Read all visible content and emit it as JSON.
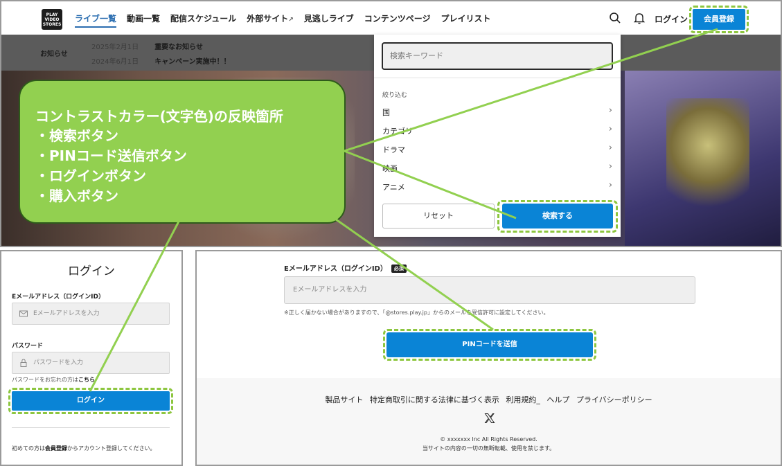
{
  "header": {
    "logo_text": [
      "PLAY",
      "VIDEO",
      "STORES"
    ],
    "nav": [
      {
        "label": "ライブ一覧"
      },
      {
        "label": "動画一覧"
      },
      {
        "label": "配信スケジュール"
      },
      {
        "label": "外部サイト"
      },
      {
        "label": "見逃しライブ"
      },
      {
        "label": "コンテンツページ"
      },
      {
        "label": "プレイリスト"
      }
    ],
    "login_label": "ログイン",
    "register_label": "会員登録",
    "icons": {
      "search": "search-icon",
      "bell": "bell-icon",
      "external": "external-link-icon"
    }
  },
  "notices": {
    "label": "お知らせ",
    "items": [
      {
        "date": "2025年2月1日",
        "text": "重要なお知らせ"
      },
      {
        "date": "2024年6月1日",
        "text": "キャンペーン実施中！！"
      }
    ]
  },
  "search_dropdown": {
    "keyword_placeholder": "検索キーワード",
    "filter_heading": "絞り込む",
    "filters": [
      "国",
      "カテゴリ",
      "ドラマ",
      "映画",
      "アニメ"
    ],
    "reset_label": "リセット",
    "submit_label": "検索する"
  },
  "callout": {
    "title": "コントラストカラー(文字色)の反映箇所",
    "items": [
      "・検索ボタン",
      "・PINコード送信ボタン",
      "・ログインボタン",
      "・購入ボタン"
    ]
  },
  "login": {
    "title": "ログイン",
    "email_label": "Eメールアドレス（ログインID）",
    "email_placeholder": "Eメールアドレスを入力",
    "password_label": "パスワード",
    "password_placeholder": "パスワードを入力",
    "forgot_prefix": "パスワードをお忘れの方は",
    "forgot_link": "こちら",
    "button_label": "ログイン",
    "first_time_prefix": "初めての方は",
    "first_time_link": "会員登録",
    "first_time_suffix": "からアカウント登録してください。"
  },
  "pin_form": {
    "email_label": "Eメールアドレス（ログインID）",
    "required_badge": "必須",
    "email_placeholder": "Eメールアドレスを入力",
    "note": "※正しく届かない場合がありますので、「@stores.play.jp」からのメールを受信許可に設定してください。",
    "button_label": "PINコードを送信"
  },
  "footer": {
    "links": [
      "製品サイト",
      "特定商取引に関する法律に基づく表示",
      "利用規約_",
      "ヘルプ",
      "プライバシーポリシー"
    ],
    "copyright": "© xxxxxxx Inc All Rights Reserved.",
    "notice": "当サイトの内容の一切の無断転載、使用を禁じます。"
  },
  "colors": {
    "accent_blue": "#0a84d6",
    "callout_green": "#92d050",
    "dash_green": "#8dc63f"
  }
}
